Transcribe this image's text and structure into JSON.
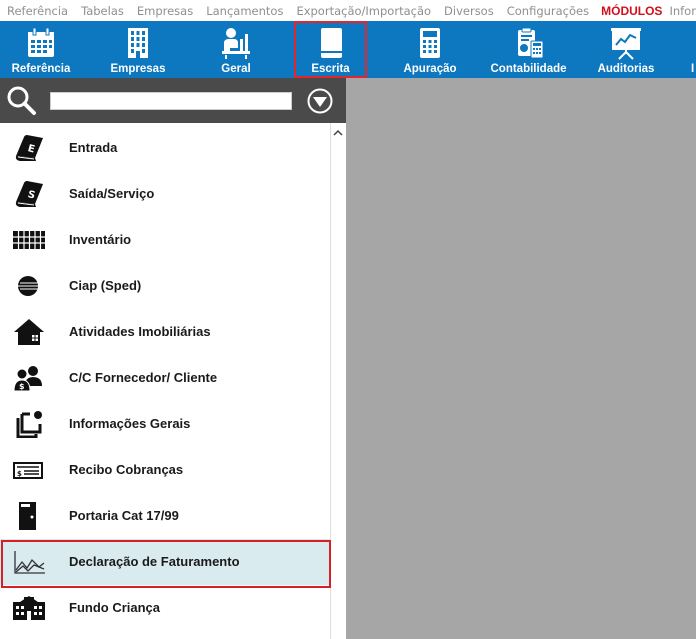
{
  "menu": {
    "items": [
      "Referência",
      "Tabelas",
      "Empresas",
      "Lançamentos",
      "Exportação/Importação",
      "Diversos",
      "Configurações"
    ],
    "active_item": "MÓDULOS",
    "partial_item": "Informações"
  },
  "toolbar": {
    "background": "#0d78bf",
    "items": [
      {
        "label": "Referência",
        "icon": "calendar-icon"
      },
      {
        "label": "Empresas",
        "icon": "building-icon"
      },
      {
        "label": "Geral",
        "icon": "person-at-desk-icon"
      },
      {
        "label": "Escrita",
        "icon": "book-icon",
        "selected": true
      },
      {
        "label": "Apuração",
        "icon": "calculator-icon"
      },
      {
        "label": "Contabilidade",
        "icon": "accounting-icon"
      },
      {
        "label": "Auditorias",
        "icon": "presentation-chart-icon"
      },
      {
        "label": "I",
        "icon": ""
      }
    ]
  },
  "search": {
    "value": "",
    "placeholder": ""
  },
  "list": {
    "items": [
      {
        "label": "Entrada",
        "icon": "book-e-icon"
      },
      {
        "label": "Saída/Serviço",
        "icon": "book-s-icon"
      },
      {
        "label": "Inventário",
        "icon": "grid-icon"
      },
      {
        "label": "Ciap (Sped)",
        "icon": "globe-icon"
      },
      {
        "label": "Atividades Imobiliárias",
        "icon": "house-icon"
      },
      {
        "label": "C/C Fornecedor/ Cliente",
        "icon": "people-money-icon"
      },
      {
        "label": "Informações Gerais",
        "icon": "documents-icon"
      },
      {
        "label": "Recibo Cobranças",
        "icon": "receipt-icon"
      },
      {
        "label": "Portaria Cat 17/99",
        "icon": "door-icon"
      },
      {
        "label": "Declaração de Faturamento",
        "icon": "line-chart-icon",
        "highlighted": true
      },
      {
        "label": "Fundo Criança",
        "icon": "school-icon"
      }
    ]
  },
  "colors": {
    "accent_red": "#d62028",
    "highlight_bg": "#d9ebee",
    "workspace": "#a6a6a6"
  }
}
